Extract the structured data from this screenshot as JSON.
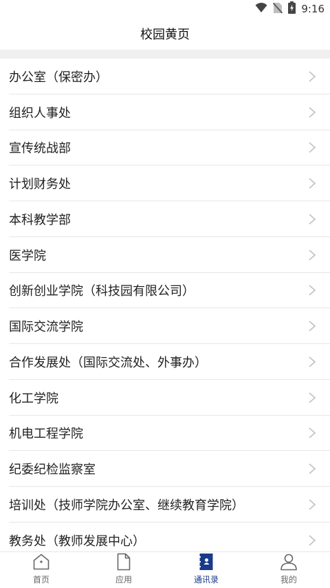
{
  "status_bar": {
    "time": "9:16",
    "icons": [
      "wifi-icon",
      "no-sim-icon",
      "battery-charging-icon"
    ]
  },
  "header": {
    "title": "校园黄页"
  },
  "departments": [
    {
      "label": "办公室（保密办）"
    },
    {
      "label": "组织人事处"
    },
    {
      "label": "宣传统战部"
    },
    {
      "label": "计划财务处"
    },
    {
      "label": "本科教学部"
    },
    {
      "label": "医学院"
    },
    {
      "label": "创新创业学院（科技园有限公司）"
    },
    {
      "label": "国际交流学院"
    },
    {
      "label": "合作发展处（国际交流处、外事办）"
    },
    {
      "label": "化工学院"
    },
    {
      "label": "机电工程学院"
    },
    {
      "label": "纪委纪检监察室"
    },
    {
      "label": "培训处（技师学院办公室、继续教育学院）"
    },
    {
      "label": "教务处（教师发展中心）"
    }
  ],
  "tab_bar": {
    "tabs": [
      {
        "label": "首页",
        "icon": "home-icon",
        "active": false
      },
      {
        "label": "应用",
        "icon": "document-icon",
        "active": false
      },
      {
        "label": "通讯录",
        "icon": "contacts-book-icon",
        "active": true
      },
      {
        "label": "我的",
        "icon": "person-icon",
        "active": false
      }
    ]
  },
  "colors": {
    "accent": "#1a3a8a",
    "divider": "#e6e6e6",
    "section_gap": "#f0f0f0"
  }
}
